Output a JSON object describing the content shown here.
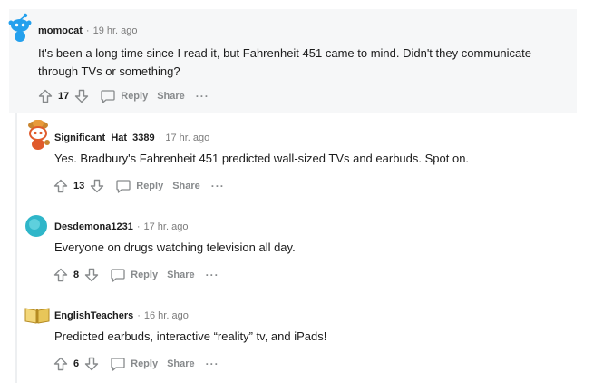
{
  "comments": [
    {
      "username": "momocat",
      "time": "19 hr. ago",
      "text": "It's been a long time since I read it, but Fahrenheit 451 came to mind. Didn't they communicate through TVs or something?",
      "score": "17",
      "reply_label": "Reply",
      "share_label": "Share",
      "more_label": "···",
      "avatar_icon": "reddit-snoo-avatar",
      "avatar_color": "#24a0ed"
    },
    {
      "username": "Significant_Hat_3389",
      "time": "17 hr. ago",
      "text": "Yes. Bradbury's Fahrenheit 451 predicted wall-sized TVs and earbuds. Spot on.",
      "score": "13",
      "reply_label": "Reply",
      "share_label": "Share",
      "more_label": "···",
      "avatar_icon": "snoo-firefighter-avatar",
      "avatar_color": "#e05a2b"
    },
    {
      "username": "Desdemona1231",
      "time": "17 hr. ago",
      "text": "Everyone on drugs watching television all day.",
      "score": "8",
      "reply_label": "Reply",
      "share_label": "Share",
      "more_label": "···",
      "avatar_icon": "teal-circle-avatar",
      "avatar_color": "#2fb6c9"
    },
    {
      "username": "EnglishTeachers",
      "time": "16 hr. ago",
      "text": "Predicted earbuds, interactive “reality” tv, and iPads!",
      "score": "6",
      "reply_label": "Reply",
      "share_label": "Share",
      "more_label": "···",
      "avatar_icon": "open-book-avatar",
      "avatar_color": "#e8c659"
    }
  ],
  "meta_separator": "·"
}
